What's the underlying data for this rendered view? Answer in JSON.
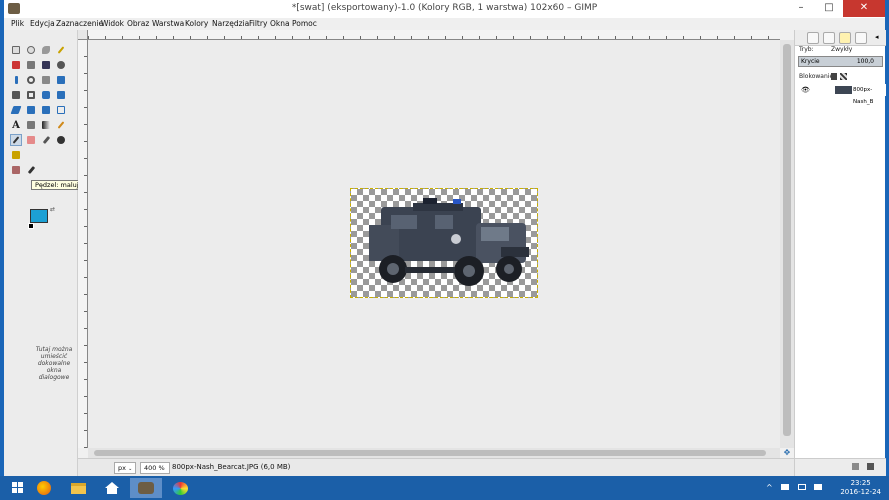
{
  "window": {
    "title": "*[swat] (eksportowany)-1.0 (Kolory RGB, 1 warstwa) 102x60 – GIMP",
    "minimize": "–",
    "maximize": "□",
    "close": "✕"
  },
  "menu": [
    "Plik",
    "Edycja",
    "Zaznaczenie",
    "Widok",
    "Obraz",
    "Warstwa",
    "Kolory",
    "Narzędzia",
    "Filtry",
    "Okna",
    "Pomoc"
  ],
  "toolbox": {
    "tooltip": "Pędzel: maluje płynnymi pociągnięciami pędzla",
    "tooltip_arrow": "▶",
    "dock_hint": "Tutaj można umieścić dokowalne okna dialogowe",
    "fg_color": "#1ca0d4",
    "bg_color": "#ffffff"
  },
  "statusbar": {
    "unit": "px",
    "zoom": "400 %",
    "file_info": "800px-Nash_Bearcat.JPG (6,0 MB)"
  },
  "layers_dock": {
    "mode_label": "Tryb:",
    "mode_value": "Zwykły",
    "opacity_label": "Krycie",
    "opacity_value": "100,0",
    "opacity_percent": 100,
    "lock_label": "Blokowanie:",
    "layer_name": "800px-Nash_B"
  },
  "taskbar": {
    "time": "23:25",
    "date": "2016-12-24",
    "tray_chevron": "^"
  }
}
